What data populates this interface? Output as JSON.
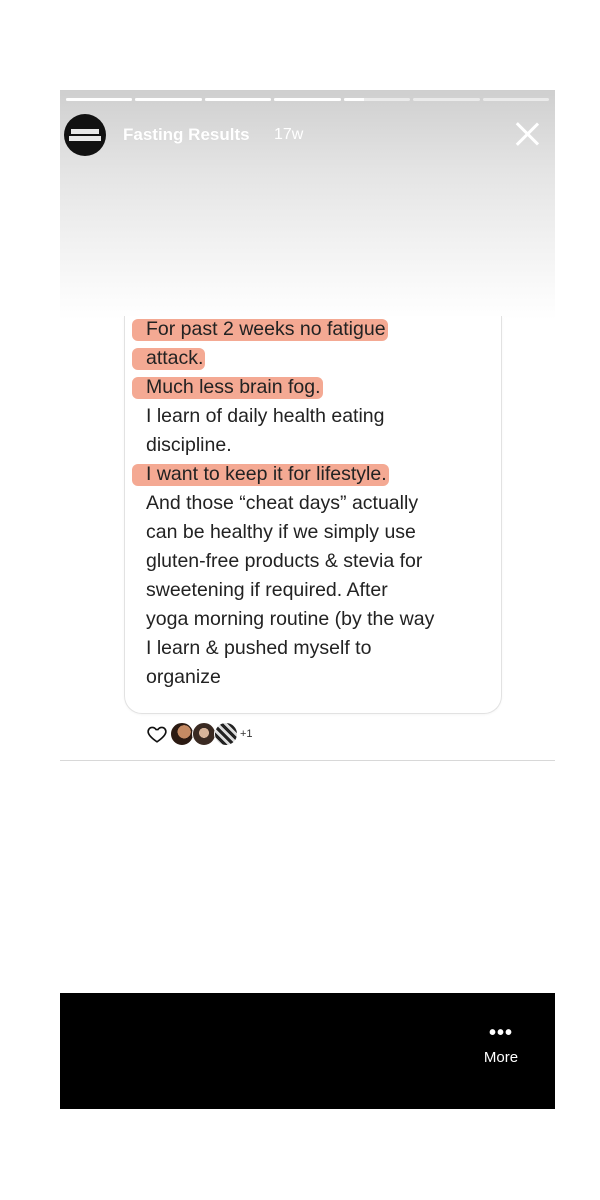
{
  "story": {
    "account_name": "Fasting Results",
    "age": "17w",
    "progress_segments": [
      1,
      1,
      1,
      1,
      0.3,
      0,
      0
    ],
    "avatar_icon": "brand-logo-icon"
  },
  "post": {
    "lines": [
      {
        "text": "For past 2 weeks no fatigue",
        "highlight": true
      },
      {
        "text": "attack.",
        "highlight": true
      },
      {
        "text": "Much less brain fog.",
        "highlight": true
      },
      {
        "text": "I learn of daily health eating",
        "highlight": false
      },
      {
        "text": "discipline.",
        "highlight": false
      },
      {
        "text": "I want to keep it for lifestyle.",
        "highlight": true
      },
      {
        "text": "And those “cheat days” actually",
        "highlight": false
      },
      {
        "text": "can be healthy if we simply use",
        "highlight": false
      },
      {
        "text": "gluten-free products & stevia for",
        "highlight": false
      },
      {
        "text": "sweetening if required. After",
        "highlight": false
      },
      {
        "text": "yoga morning routine (by the way",
        "highlight": false
      },
      {
        "text": "I learn & pushed myself to",
        "highlight": false
      },
      {
        "text": "organize",
        "highlight": false
      }
    ],
    "highlight_color": "#f29a80",
    "reactions_extra": "+1"
  },
  "footer": {
    "more_label": "More",
    "more_icon": "ellipsis-icon"
  }
}
